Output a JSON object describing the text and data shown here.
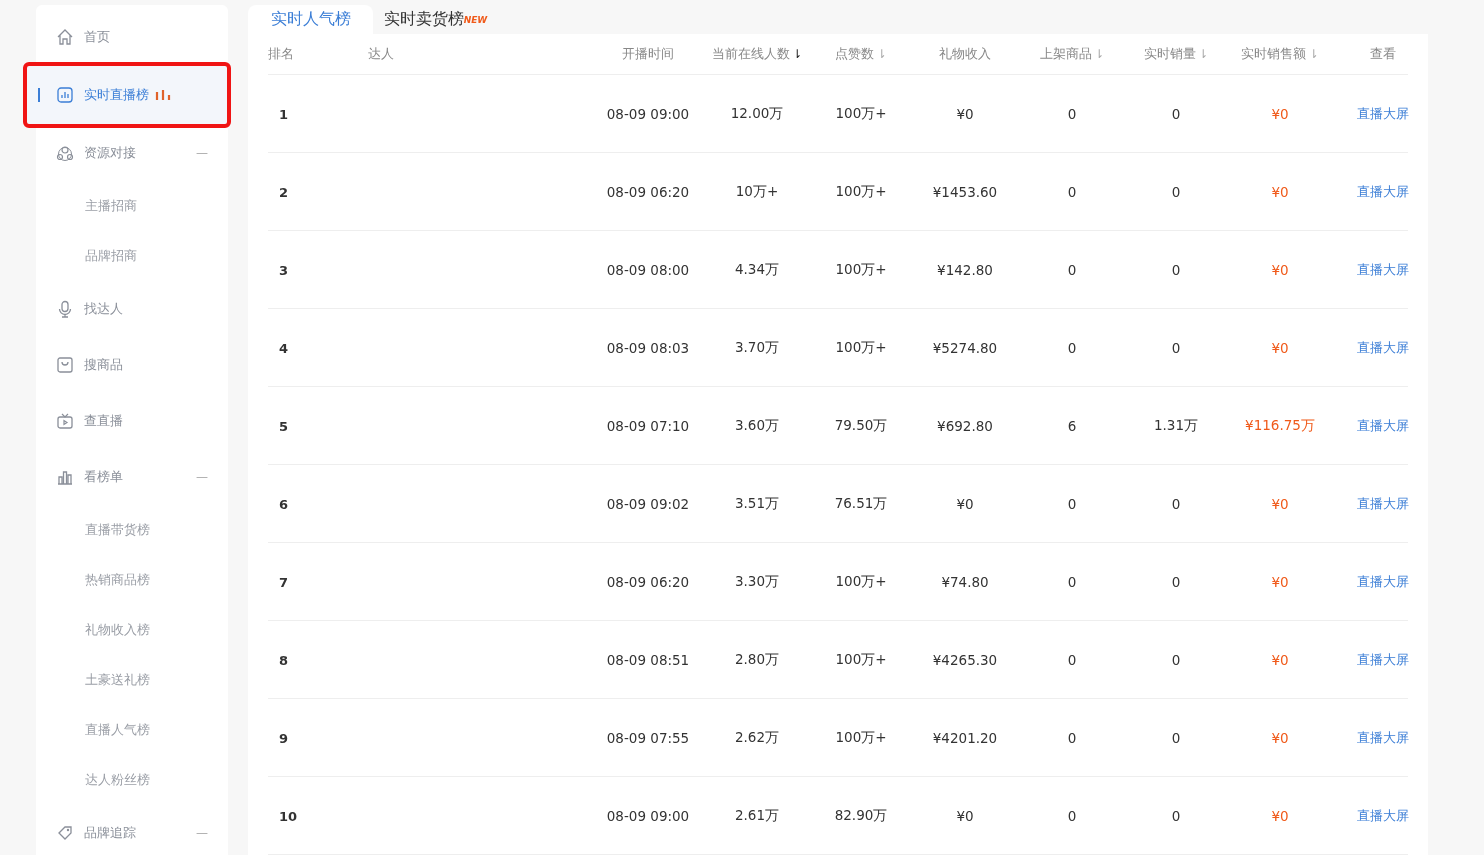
{
  "sidebar": {
    "items": [
      {
        "label": "首页",
        "selected": false,
        "highlighted": false
      },
      {
        "label": "实时直播榜",
        "selected": true,
        "highlighted": true,
        "hot": true
      },
      {
        "label": "资源对接",
        "selected": false,
        "highlighted": false,
        "toggle": "—",
        "children": [
          {
            "label": "主播招商"
          },
          {
            "label": "品牌招商"
          }
        ]
      },
      {
        "label": "找达人",
        "selected": false,
        "highlighted": false
      },
      {
        "label": "搜商品",
        "selected": false,
        "highlighted": false
      },
      {
        "label": "查直播",
        "selected": false,
        "highlighted": false
      },
      {
        "label": "看榜单",
        "selected": false,
        "highlighted": false,
        "toggle": "—",
        "children": [
          {
            "label": "直播带货榜"
          },
          {
            "label": "热销商品榜"
          },
          {
            "label": "礼物收入榜"
          },
          {
            "label": "土豪送礼榜"
          },
          {
            "label": "直播人气榜"
          },
          {
            "label": "达人粉丝榜"
          }
        ]
      },
      {
        "label": "品牌追踪",
        "selected": false,
        "highlighted": false,
        "toggle": "—"
      }
    ]
  },
  "tabs": [
    {
      "label": "实时人气榜",
      "selected": true
    },
    {
      "label": "实时卖货榜",
      "selected": false,
      "badge": "NEW"
    }
  ],
  "table": {
    "columns": [
      {
        "label": "排名"
      },
      {
        "label": "达人"
      },
      {
        "label": "开播时间"
      },
      {
        "label": "当前在线人数",
        "sort_mark": "⇂",
        "sort_active": true
      },
      {
        "label": "点赞数",
        "sort_mark": "⇂",
        "sort_active": false
      },
      {
        "label": "礼物收入"
      },
      {
        "label": "上架商品",
        "sort_mark": "⇂",
        "sort_active": false
      },
      {
        "label": "实时销量",
        "sort_mark": "⇂",
        "sort_active": false
      },
      {
        "label": "实时销售额",
        "sort_mark": "⇂",
        "sort_active": false
      },
      {
        "label": "查看"
      }
    ],
    "rows": [
      {
        "rank": "1",
        "time": "08-09 09:00",
        "online": "12.00万",
        "likes": "100万+",
        "gift": "¥0",
        "listed": "0",
        "sales": "0",
        "revenue": "¥0",
        "link": "直播大屏"
      },
      {
        "rank": "2",
        "time": "08-09 06:20",
        "online": "10万+",
        "likes": "100万+",
        "gift": "¥1453.60",
        "listed": "0",
        "sales": "0",
        "revenue": "¥0",
        "link": "直播大屏"
      },
      {
        "rank": "3",
        "time": "08-09 08:00",
        "online": "4.34万",
        "likes": "100万+",
        "gift": "¥142.80",
        "listed": "0",
        "sales": "0",
        "revenue": "¥0",
        "link": "直播大屏"
      },
      {
        "rank": "4",
        "time": "08-09 08:03",
        "online": "3.70万",
        "likes": "100万+",
        "gift": "¥5274.80",
        "listed": "0",
        "sales": "0",
        "revenue": "¥0",
        "link": "直播大屏"
      },
      {
        "rank": "5",
        "time": "08-09 07:10",
        "online": "3.60万",
        "likes": "79.50万",
        "gift": "¥692.80",
        "listed": "6",
        "sales": "1.31万",
        "revenue": "¥116.75万",
        "link": "直播大屏"
      },
      {
        "rank": "6",
        "time": "08-09 09:02",
        "online": "3.51万",
        "likes": "76.51万",
        "gift": "¥0",
        "listed": "0",
        "sales": "0",
        "revenue": "¥0",
        "link": "直播大屏"
      },
      {
        "rank": "7",
        "time": "08-09 06:20",
        "online": "3.30万",
        "likes": "100万+",
        "gift": "¥74.80",
        "listed": "0",
        "sales": "0",
        "revenue": "¥0",
        "link": "直播大屏"
      },
      {
        "rank": "8",
        "time": "08-09 08:51",
        "online": "2.80万",
        "likes": "100万+",
        "gift": "¥4265.30",
        "listed": "0",
        "sales": "0",
        "revenue": "¥0",
        "link": "直播大屏"
      },
      {
        "rank": "9",
        "time": "08-09 07:55",
        "online": "2.62万",
        "likes": "100万+",
        "gift": "¥4201.20",
        "listed": "0",
        "sales": "0",
        "revenue": "¥0",
        "link": "直播大屏"
      },
      {
        "rank": "10",
        "time": "08-09 09:00",
        "online": "2.61万",
        "likes": "82.90万",
        "gift": "¥0",
        "listed": "0",
        "sales": "0",
        "revenue": "¥0",
        "link": "直播大屏"
      }
    ]
  }
}
